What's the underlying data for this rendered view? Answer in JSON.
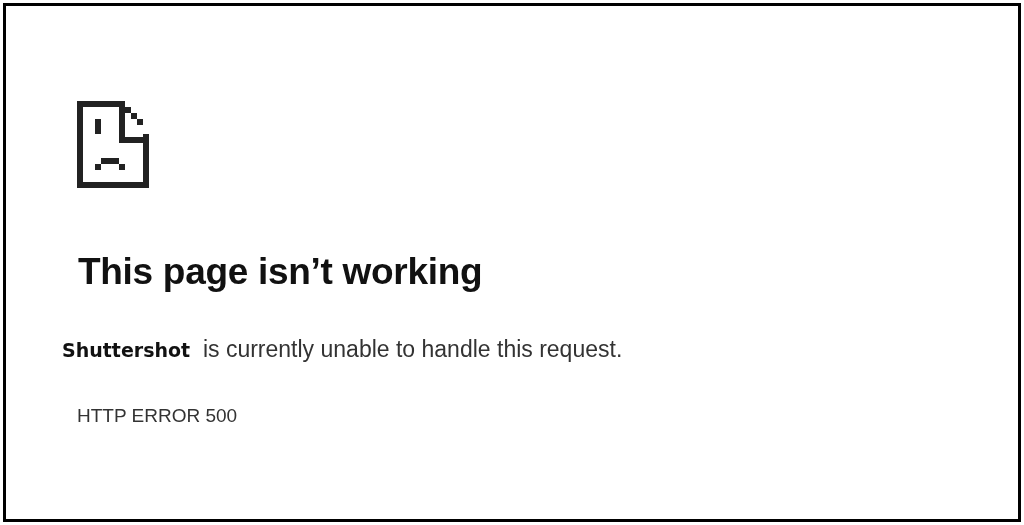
{
  "heading": "This page isn’t working",
  "message": "**Shuttershot**  is currently unable to handle this request.",
  "error_code": "HTTP ERROR 500"
}
